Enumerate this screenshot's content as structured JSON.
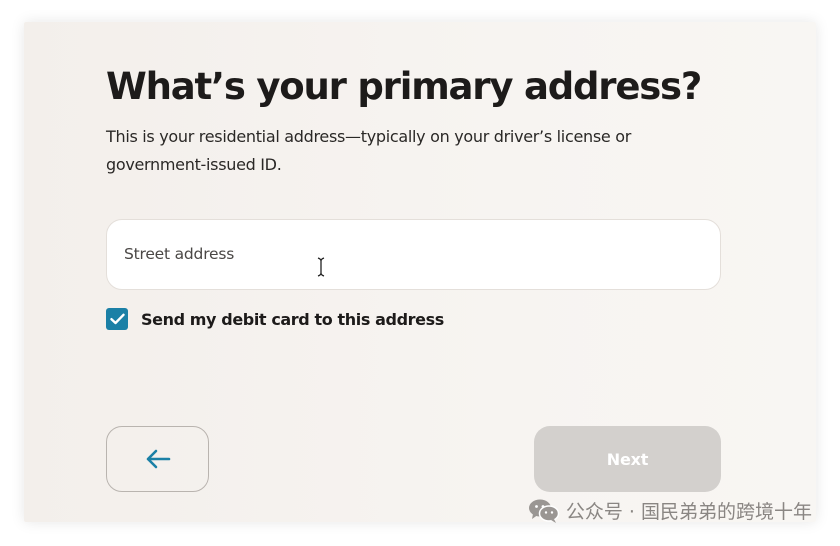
{
  "form": {
    "title": "What’s your primary address?",
    "subtitle": "This is your residential address—typically on your driver’s license or government-issued ID.",
    "street_address": {
      "value": "",
      "placeholder": "Street address"
    },
    "debit_card_checkbox": {
      "label": "Send my debit card to this address",
      "checked": true
    }
  },
  "navigation": {
    "back_icon": "arrow-left-icon",
    "next_label": "Next",
    "next_enabled": false
  },
  "watermark": {
    "icon": "wechat-icon",
    "text": "公众号 · 国民弟弟的跨境十年"
  },
  "colors": {
    "accent": "#1b80a6",
    "disabled_button": "#d3d0cd",
    "background": "#f5f2ef"
  }
}
